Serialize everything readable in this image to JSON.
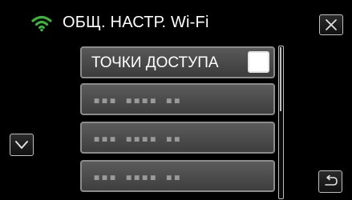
{
  "header": {
    "title": "ОБЩ. НАСТР. Wi-Fi",
    "wifi_icon": "wifi-icon",
    "close_icon": "close-icon"
  },
  "list": {
    "items": [
      {
        "label": "ТОЧКИ ДОСТУПА",
        "checked": false
      },
      {
        "label": "▪▪▪ ▪▪▪▪ ▪▪"
      },
      {
        "label": "▪▪▪ ▪▪▪▪ ▪▪"
      },
      {
        "label": "▪▪▪ ▪▪▪▪ ▪▪"
      }
    ]
  },
  "controls": {
    "down_icon": "chevron-down-icon",
    "back_icon": "back-arrow-icon"
  },
  "colors": {
    "wifi_accent": "#3cb43c",
    "item_border": "#8c8c8c",
    "button_border": "#bfbfbf",
    "background": "#000000"
  }
}
